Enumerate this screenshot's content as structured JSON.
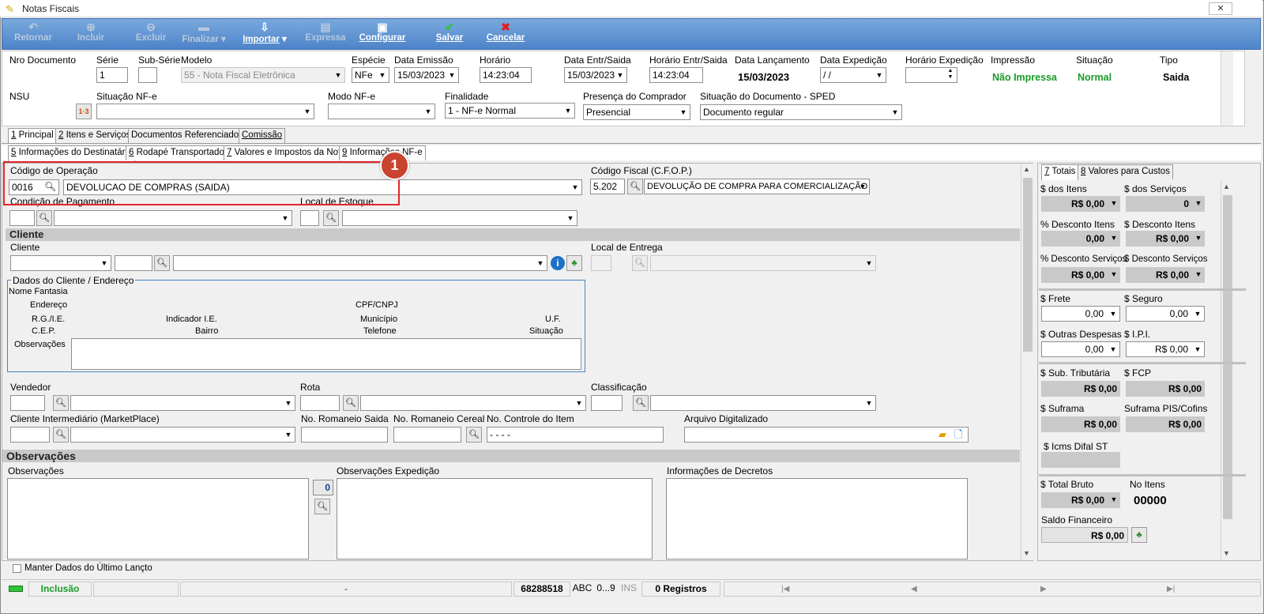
{
  "window": {
    "title": "Notas Fiscais",
    "close_glyph": "✕"
  },
  "toolbar": [
    {
      "label": "Retornar",
      "icon": "undo-icon",
      "enabled": false
    },
    {
      "label": "Incluir",
      "icon": "add-icon",
      "enabled": false
    },
    {
      "label": "Excluir",
      "icon": "delete-icon",
      "enabled": false
    },
    {
      "label": "Finalizar",
      "icon": "finalize-icon",
      "enabled": false
    },
    {
      "label": "Importar",
      "icon": "import-icon",
      "enabled": true
    },
    {
      "label": "Expressa",
      "icon": "express-icon",
      "enabled": false
    },
    {
      "label": "Configurar",
      "icon": "configure-icon",
      "enabled": true
    },
    {
      "label": "Salvar",
      "icon": "check-icon",
      "enabled": true
    },
    {
      "label": "Cancelar",
      "icon": "cancel-icon",
      "enabled": true
    }
  ],
  "header": {
    "nro_documento": {
      "label": "Nro Documento",
      "value": ""
    },
    "serie": {
      "label": "Série",
      "value": "1"
    },
    "sub_serie": {
      "label": "Sub-Série",
      "value": ""
    },
    "modelo": {
      "label": "Modelo",
      "value": "55 - Nota Fiscal Eletrônica"
    },
    "especie": {
      "label": "Espécie",
      "value": "NFe"
    },
    "data_emissao": {
      "label": "Data Emissão",
      "value": "15/03/2023"
    },
    "horario": {
      "label": "Horário",
      "value": "14:23:04"
    },
    "data_entr_saida": {
      "label": "Data Entr/Saida",
      "value": "15/03/2023"
    },
    "horario_entr_saida": {
      "label": "Horário Entr/Saida",
      "value": "14:23:04"
    },
    "data_lancamento": {
      "label": "Data Lançamento",
      "value": "15/03/2023"
    },
    "data_expedicao": {
      "label": "Data Expedição",
      "value": " / /"
    },
    "horario_expedicao": {
      "label": "Horário Expedição",
      "value": ""
    },
    "impressao": {
      "label": "Impressão",
      "value": "Não Impressa"
    },
    "situacao": {
      "label": "Situação",
      "value": "Normal"
    },
    "tipo": {
      "label": "Tipo",
      "value": "Saida"
    },
    "nsu": {
      "label": "NSU",
      "value": ""
    },
    "situacao_nfe": {
      "label": "Situação NF-e",
      "value": ""
    },
    "modo_nfe": {
      "label": "Modo NF-e",
      "value": ""
    },
    "finalidade": {
      "label": "Finalidade",
      "value": "1 - NF-e Normal"
    },
    "presenca_comprador": {
      "label": "Presença do Comprador",
      "value": "Presencial"
    },
    "situacao_sped": {
      "label": "Situação do Documento - SPED",
      "value": "Documento regular"
    }
  },
  "tabs_main": [
    {
      "key": "1",
      "label": " Principal"
    },
    {
      "key": "2",
      "label": " Itens e Serviços"
    },
    {
      "key": "",
      "label": "Documentos Referenciados"
    },
    {
      "key": "",
      "label": "Comissão"
    }
  ],
  "tabs_sub": [
    {
      "key": "5",
      "label": " Informações do Destinatário"
    },
    {
      "key": "6",
      "label": " Rodapé Transportador"
    },
    {
      "key": "7",
      "label": " Valores e Impostos da Nota"
    },
    {
      "key": "9",
      "label": " Informações NF-e"
    }
  ],
  "operacao": {
    "label": "Código de Operação",
    "code": "0016",
    "desc": "DEVOLUCAO DE COMPRAS (SAIDA)"
  },
  "cfop": {
    "label": "Código Fiscal (C.F.O.P.)",
    "code": "5.202",
    "desc": "DEVOLUÇÃO DE COMPRA PARA COMERCIALIZAÇÃO"
  },
  "condicao_pagamento": {
    "label": "Condição de Pagamento"
  },
  "local_estoque": {
    "label": "Local de Estoque"
  },
  "cliente_section": "Cliente",
  "cliente": {
    "label": "Cliente"
  },
  "local_entrega": {
    "label": "Local de Entrega"
  },
  "dados_cliente": {
    "legend": "Dados do Cliente / Endereço",
    "nome_fantasia": "Nome Fantasia",
    "endereco": "Endereço",
    "cpf_cnpj": "CPF/CNPJ",
    "rg_ie": "R.G./I.E.",
    "indicador_ie": "Indicador I.E.",
    "municipio": "Município",
    "uf": "U.F.",
    "cep": "C.E.P.",
    "bairro": "Bairro",
    "telefone": "Telefone",
    "situacao": "Situação",
    "observacoes": "Observações"
  },
  "vendedor": {
    "label": "Vendedor"
  },
  "rota": {
    "label": "Rota"
  },
  "classificacao": {
    "label": "Classificação"
  },
  "cliente_intermediario": {
    "label": "Cliente Intermediário (MarketPlace)"
  },
  "no_romaneio_saida": {
    "label": "No. Romaneio Saida"
  },
  "no_romaneio_cereal": {
    "label": "No. Romaneio Cereal"
  },
  "no_controle_item": {
    "label": "No. Controle do Item",
    "value": " -   -   -  -"
  },
  "arquivo_digitalizado": {
    "label": "Arquivo Digitalizado"
  },
  "observacoes_section": "Observações",
  "obs": {
    "label": "Observações",
    "counter": "0"
  },
  "obs_expedicao": {
    "label": "Observações Expedição"
  },
  "info_decretos": {
    "label": "Informações de Decretos"
  },
  "manter_dados": {
    "label": "Manter Dados do Último Lançto",
    "checked": false
  },
  "totals_tabs": [
    {
      "key": "7",
      "label": " Totais"
    },
    {
      "key": "8",
      "label": " Valores para Custos"
    }
  ],
  "totals": {
    "dos_itens": {
      "label": "$ dos Itens",
      "value": "R$ 0,00"
    },
    "dos_servicos": {
      "label": "$ dos Serviços",
      "value": "0"
    },
    "pct_desc_itens": {
      "label": "% Desconto Itens",
      "value": "0,00"
    },
    "desc_itens": {
      "label": "$ Desconto Itens",
      "value": "R$ 0,00"
    },
    "pct_desc_servicos": {
      "label": "% Desconto Serviços",
      "value": "R$ 0,00"
    },
    "desc_servicos": {
      "label": "$ Desconto Serviços",
      "value": "R$ 0,00"
    },
    "frete": {
      "label": "$ Frete",
      "value": "0,00"
    },
    "seguro": {
      "label": "$ Seguro",
      "value": "0,00"
    },
    "outras_despesas": {
      "label": "$ Outras Despesas",
      "value": "0,00"
    },
    "ipi": {
      "label": "$ I.P.I.",
      "value": "R$ 0,00"
    },
    "sub_tributaria": {
      "label": "$ Sub. Tributária",
      "value": "R$ 0,00"
    },
    "fcp": {
      "label": "$ FCP",
      "value": "R$ 0,00"
    },
    "suframa": {
      "label": "$ Suframa",
      "value": "R$ 0,00"
    },
    "suframa_pis": {
      "label": "Suframa PIS/Cofins",
      "value": "R$ 0,00"
    },
    "icms_difal_st": {
      "label": "$ Icms Difal ST",
      "value": ""
    },
    "total_bruto": {
      "label": "$ Total Bruto",
      "value": "R$ 0,00"
    },
    "no_itens": {
      "label": "No Itens",
      "value": "00000"
    },
    "saldo_financeiro": {
      "label": "Saldo Financeiro",
      "value": "R$ 0,00"
    }
  },
  "statusbar": {
    "mode": "Inclusão",
    "dash": "-",
    "id": "68288518",
    "abc": "ABC",
    "num": "0...9",
    "ins": "INS",
    "registros": "0 Registros",
    "nav": [
      "|◀",
      "◀",
      "▶",
      "▶|"
    ]
  },
  "callout": {
    "number": "1"
  },
  "colors": {
    "toolbar": "#5a8fd0",
    "status_green": "#1a9b28",
    "callout_red": "#e0262a"
  }
}
